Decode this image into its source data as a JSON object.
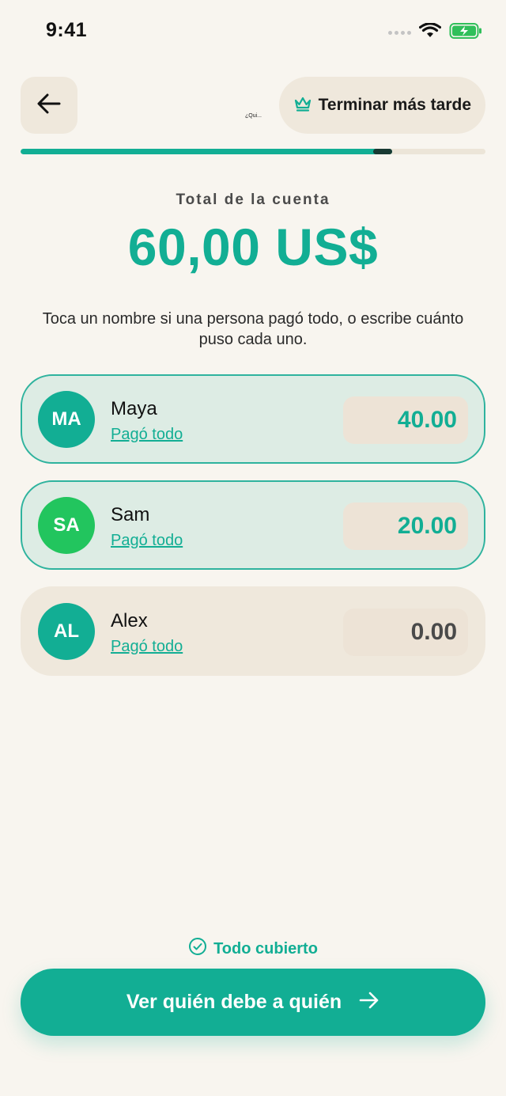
{
  "status_bar": {
    "time": "9:41"
  },
  "header": {
    "tiny_title": "¿Qui...",
    "finish_later_label": "Terminar más tarde"
  },
  "progress": {
    "fraction": 0.8
  },
  "summary": {
    "total_label": "Total de la cuenta",
    "total_amount": "60,00 US$",
    "instructions": "Toca un nombre si una persona pagó todo, o escribe cuánto puso cada uno."
  },
  "people": [
    {
      "initials": "MA",
      "name": "Maya",
      "paid_all_label": "Pagó todo",
      "amount": "40.00",
      "active": true,
      "avatar_color": "#12ae94",
      "amount_color": "#12ae94"
    },
    {
      "initials": "SA",
      "name": "Sam",
      "paid_all_label": "Pagó todo",
      "amount": "20.00",
      "active": true,
      "avatar_color": "#22c55e",
      "amount_color": "#12ae94"
    },
    {
      "initials": "AL",
      "name": "Alex",
      "paid_all_label": "Pagó todo",
      "amount": "0.00",
      "active": false,
      "avatar_color": "#12ae94",
      "amount_color": "#4a4a4a"
    }
  ],
  "footer": {
    "covered_status": "Todo cubierto",
    "cta_label": "Ver quién debe a quién"
  },
  "colors": {
    "accent": "#12ae94",
    "background": "#f8f5ef",
    "card": "#efe8dc",
    "active_card": "#ddece4"
  },
  "icons": {
    "back": "arrow-left-icon",
    "crown": "crown-icon",
    "check": "check-circle-icon",
    "forward": "arrow-right-icon"
  }
}
